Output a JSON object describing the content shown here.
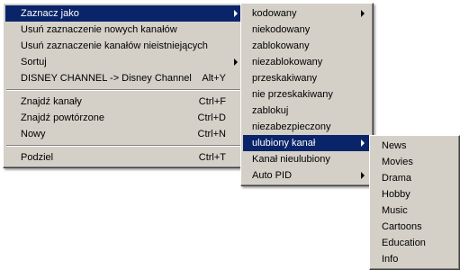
{
  "main_menu": {
    "items": [
      {
        "label": "Zaznacz jako",
        "shortcut": "",
        "submenu": true,
        "highlighted": true
      },
      {
        "label": "Usuń zaznaczenie nowych kanałów",
        "shortcut": "",
        "submenu": false
      },
      {
        "label": "Usuń zaznaczenie kanałów nieistniejących",
        "shortcut": "",
        "submenu": false
      },
      {
        "label": "Sortuj",
        "shortcut": "",
        "submenu": true
      },
      {
        "label": "DISNEY CHANNEL -> Disney Channel",
        "shortcut": "Alt+Y",
        "submenu": false
      },
      {
        "label": "Znajdź kanały",
        "shortcut": "Ctrl+F",
        "submenu": false
      },
      {
        "label": "Znajdź powtórzone",
        "shortcut": "Ctrl+D",
        "submenu": false
      },
      {
        "label": "Nowy",
        "shortcut": "Ctrl+N",
        "submenu": false
      },
      {
        "label": "Podziel",
        "shortcut": "Ctrl+T",
        "submenu": false
      }
    ]
  },
  "mark_as_submenu": {
    "items": [
      {
        "label": "kodowany",
        "submenu": true
      },
      {
        "label": "niekodowany"
      },
      {
        "label": "zablokowany"
      },
      {
        "label": "niezablokowany"
      },
      {
        "label": "przeskakiwany"
      },
      {
        "label": "nie przeskakiwany"
      },
      {
        "label": "zablokuj"
      },
      {
        "label": "niezabezpieczony"
      },
      {
        "label": "ulubiony kanał",
        "submenu": true,
        "highlighted": true
      },
      {
        "label": "Kanał nieulubiony"
      },
      {
        "label": "Auto PID",
        "submenu": true
      }
    ]
  },
  "favorite_submenu": {
    "items": [
      {
        "label": "News"
      },
      {
        "label": "Movies"
      },
      {
        "label": "Drama"
      },
      {
        "label": "Hobby"
      },
      {
        "label": "Music"
      },
      {
        "label": "Cartoons"
      },
      {
        "label": "Education"
      },
      {
        "label": "Info"
      }
    ]
  },
  "colors": {
    "menu_background": "#d4d0c8",
    "highlight": "#0a246a",
    "highlight_text": "#ffffff"
  }
}
